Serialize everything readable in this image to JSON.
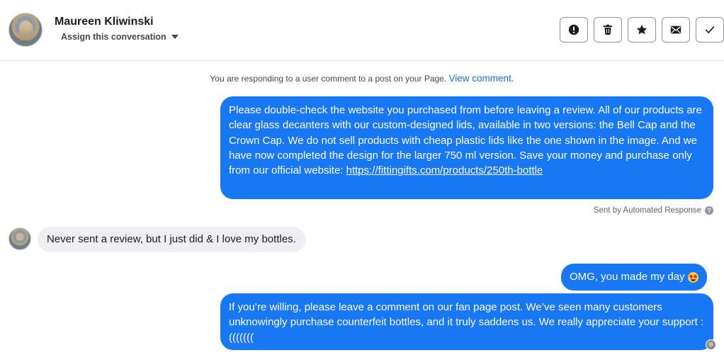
{
  "header": {
    "contact_name": "Maureen Kliwinski",
    "assign_label": "Assign this conversation",
    "tools": [
      {
        "name": "report",
        "icon": "exclamation-icon"
      },
      {
        "name": "delete",
        "icon": "trash-icon"
      },
      {
        "name": "star",
        "icon": "star-icon"
      },
      {
        "name": "mark-unread",
        "icon": "envelope-icon"
      },
      {
        "name": "done",
        "icon": "checkmark-icon"
      }
    ]
  },
  "notice": {
    "text": "You are responding to a user comment to a post on your Page.",
    "link": "View comment."
  },
  "messages": {
    "m1": {
      "text": "Please double-check the website you purchased from before leaving a review. All of our products are clear glass decanters with our custom-designed lids, available in two versions: the Bell Cap and the Crown Cap. We do not sell products with cheap plastic lids like the one shown in the image. And we have now completed the design for the larger 750 ml version. Save your money and purchase only from our official website: ",
      "link": "https://fittingifts.com/products/250th-bottle",
      "meta": "Sent by Automated Response"
    },
    "m2": {
      "text": "Never sent a review, but I  just did & I love my bottles."
    },
    "m3": {
      "text": "OMG, you made my day",
      "emoji": "heart-eyes-emoji"
    },
    "m4": {
      "text": "If you’re willing, please leave a comment on our fan page post. We’ve seen many customers unknowingly purchase counterfeit bottles, and it truly saddens us. We really appreciate your support :((((((("
    }
  },
  "colors": {
    "outgoing_bubble": "#1877f2",
    "incoming_bubble": "#eeeff1",
    "link": "#1a6ed8"
  }
}
